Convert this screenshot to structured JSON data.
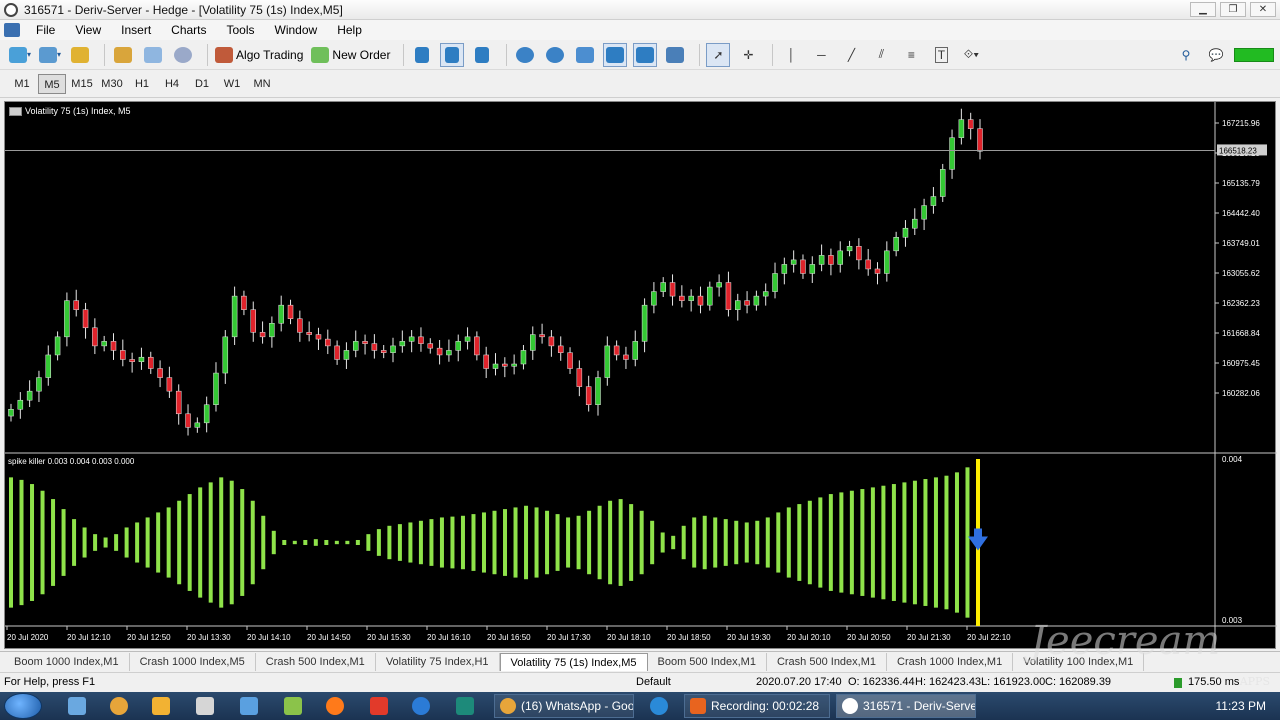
{
  "window": {
    "title": "316571 - Deriv-Server - Hedge - [Volatility 75 (1s) Index,M5]",
    "controls": [
      "▁",
      "❐",
      "✕"
    ]
  },
  "menu": [
    "File",
    "View",
    "Insert",
    "Charts",
    "Tools",
    "Window",
    "Help"
  ],
  "toolbar": {
    "algo_trading": "Algo Trading",
    "new_order": "New Order"
  },
  "timeframes": [
    "M1",
    "M5",
    "M15",
    "M30",
    "H1",
    "H4",
    "D1",
    "W1",
    "MN"
  ],
  "active_timeframe": "M5",
  "chart": {
    "symbol_label": "Volatility 75 (1s) Index, M5",
    "indicator_label": "spike killer 0.003 0.004 0.003 0.000",
    "current_price": "166518.23",
    "indicator_scale_top": "0.004",
    "indicator_scale_bottom": "0.003",
    "bull_color": "#34c934",
    "bear_color": "#e0232b",
    "histogram_color": "#8fe34a",
    "signal_bar_color": "#ffee00",
    "arrow_color": "#2f6fe0"
  },
  "chart_data": {
    "type": "candlestick",
    "y_ticks": [
      "167215.96",
      "165829.18",
      "165135.79",
      "164442.40",
      "163749.01",
      "163055.62",
      "162362.23",
      "161668.84",
      "160975.45",
      "160282.06"
    ],
    "ylim": [
      159900,
      167500
    ],
    "x_ticks": [
      "20 Jul 2020",
      "20 Jul 12:10",
      "20 Jul 12:50",
      "20 Jul 13:30",
      "20 Jul 14:10",
      "20 Jul 14:50",
      "20 Jul 15:30",
      "20 Jul 16:10",
      "20 Jul 16:50",
      "20 Jul 17:30",
      "20 Jul 18:10",
      "20 Jul 18:50",
      "20 Jul 19:30",
      "20 Jul 20:10",
      "20 Jul 20:50",
      "20 Jul 21:30",
      "20 Jul 22:10"
    ],
    "closes": [
      160800,
      161000,
      161200,
      161500,
      162000,
      162400,
      163200,
      163000,
      162600,
      162200,
      162300,
      162100,
      161900,
      161850,
      161950,
      161700,
      161500,
      161200,
      160700,
      160400,
      160500,
      160900,
      161600,
      162400,
      163300,
      163000,
      162500,
      162400,
      162700,
      163100,
      162800,
      162500,
      162450,
      162350,
      162200,
      161900,
      162100,
      162300,
      162250,
      162100,
      162050,
      162200,
      162300,
      162400,
      162250,
      162150,
      162000,
      162100,
      162300,
      162400,
      162000,
      161700,
      161800,
      161750,
      161800,
      162100,
      162450,
      162400,
      162200,
      162050,
      161700,
      161300,
      160900,
      161500,
      162200,
      162000,
      161900,
      162300,
      163100,
      163400,
      163600,
      163300,
      163200,
      163300,
      163100,
      163500,
      163600,
      163000,
      163200,
      163100,
      163300,
      163400,
      163800,
      164000,
      164100,
      163800,
      164000,
      164200,
      164000,
      164300,
      164400,
      164100,
      163900,
      163800,
      164300,
      164600,
      164800,
      165000,
      165300,
      165500,
      166100,
      166800,
      167200,
      167000,
      166500
    ]
  },
  "indicator_data": {
    "heights": [
      0.78,
      0.75,
      0.7,
      0.62,
      0.52,
      0.4,
      0.28,
      0.18,
      0.1,
      0.06,
      0.1,
      0.18,
      0.24,
      0.3,
      0.36,
      0.42,
      0.5,
      0.58,
      0.66,
      0.72,
      0.78,
      0.74,
      0.64,
      0.5,
      0.32,
      0.14,
      0.03,
      0.02,
      0.03,
      0.04,
      0.03,
      0.02,
      0.02,
      0.03,
      0.1,
      0.16,
      0.2,
      0.22,
      0.24,
      0.26,
      0.28,
      0.3,
      0.31,
      0.32,
      0.34,
      0.36,
      0.38,
      0.4,
      0.42,
      0.44,
      0.42,
      0.38,
      0.34,
      0.3,
      0.32,
      0.38,
      0.44,
      0.5,
      0.52,
      0.46,
      0.38,
      0.26,
      0.12,
      0.08,
      0.2,
      0.3,
      0.32,
      0.3,
      0.28,
      0.26,
      0.24,
      0.26,
      0.3,
      0.36,
      0.42,
      0.46,
      0.5,
      0.54,
      0.58,
      0.6,
      0.62,
      0.64,
      0.66,
      0.68,
      0.7,
      0.72,
      0.74,
      0.76,
      0.78,
      0.8,
      0.84,
      0.9,
      1.0
    ],
    "signal_index": 92
  },
  "tabs": [
    "Boom 1000 Index,M1",
    "Crash 1000 Index,M5",
    "Crash 500 Index,M1",
    "Volatility 75 Index,H1",
    "Volatility 75 (1s) Index,M5",
    "Boom 500 Index,M1",
    "Crash 500 Index,M1",
    "Crash 1000 Index,M1",
    "Volatility 100 Index,M1"
  ],
  "active_tab": 4,
  "status": {
    "help": "For Help, press F1",
    "profile": "Default",
    "datetime": "2020.07.20 17:40",
    "open": "O: 162336.44",
    "high": "H: 162423.43",
    "low": "L: 161923.00",
    "close": "C: 162089.39",
    "traffic": "175.50 ms"
  },
  "taskbar": {
    "whatsapp": "(16) WhatsApp - Goo...",
    "recording": "Recording: 00:02:28",
    "deriv": "316571 - Deriv-Server...",
    "time": "11:23 PM"
  },
  "watermark": {
    "text": "Jeecream",
    "sub": "APPS"
  }
}
